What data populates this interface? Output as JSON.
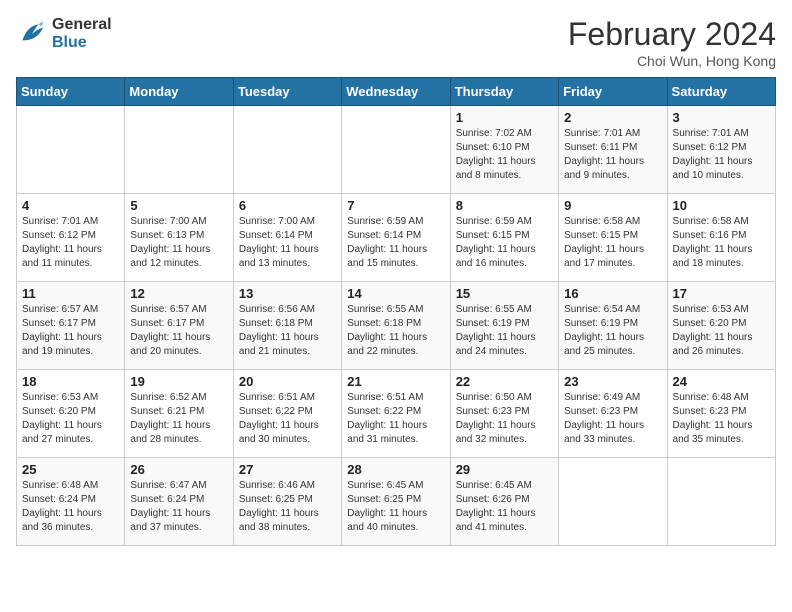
{
  "header": {
    "logo_line1": "General",
    "logo_line2": "Blue",
    "title": "February 2024",
    "subtitle": "Choi Wun, Hong Kong"
  },
  "weekdays": [
    "Sunday",
    "Monday",
    "Tuesday",
    "Wednesday",
    "Thursday",
    "Friday",
    "Saturday"
  ],
  "weeks": [
    [
      {
        "day": "",
        "info": ""
      },
      {
        "day": "",
        "info": ""
      },
      {
        "day": "",
        "info": ""
      },
      {
        "day": "",
        "info": ""
      },
      {
        "day": "1",
        "info": "Sunrise: 7:02 AM\nSunset: 6:10 PM\nDaylight: 11 hours\nand 8 minutes."
      },
      {
        "day": "2",
        "info": "Sunrise: 7:01 AM\nSunset: 6:11 PM\nDaylight: 11 hours\nand 9 minutes."
      },
      {
        "day": "3",
        "info": "Sunrise: 7:01 AM\nSunset: 6:12 PM\nDaylight: 11 hours\nand 10 minutes."
      }
    ],
    [
      {
        "day": "4",
        "info": "Sunrise: 7:01 AM\nSunset: 6:12 PM\nDaylight: 11 hours\nand 11 minutes."
      },
      {
        "day": "5",
        "info": "Sunrise: 7:00 AM\nSunset: 6:13 PM\nDaylight: 11 hours\nand 12 minutes."
      },
      {
        "day": "6",
        "info": "Sunrise: 7:00 AM\nSunset: 6:14 PM\nDaylight: 11 hours\nand 13 minutes."
      },
      {
        "day": "7",
        "info": "Sunrise: 6:59 AM\nSunset: 6:14 PM\nDaylight: 11 hours\nand 15 minutes."
      },
      {
        "day": "8",
        "info": "Sunrise: 6:59 AM\nSunset: 6:15 PM\nDaylight: 11 hours\nand 16 minutes."
      },
      {
        "day": "9",
        "info": "Sunrise: 6:58 AM\nSunset: 6:15 PM\nDaylight: 11 hours\nand 17 minutes."
      },
      {
        "day": "10",
        "info": "Sunrise: 6:58 AM\nSunset: 6:16 PM\nDaylight: 11 hours\nand 18 minutes."
      }
    ],
    [
      {
        "day": "11",
        "info": "Sunrise: 6:57 AM\nSunset: 6:17 PM\nDaylight: 11 hours\nand 19 minutes."
      },
      {
        "day": "12",
        "info": "Sunrise: 6:57 AM\nSunset: 6:17 PM\nDaylight: 11 hours\nand 20 minutes."
      },
      {
        "day": "13",
        "info": "Sunrise: 6:56 AM\nSunset: 6:18 PM\nDaylight: 11 hours\nand 21 minutes."
      },
      {
        "day": "14",
        "info": "Sunrise: 6:55 AM\nSunset: 6:18 PM\nDaylight: 11 hours\nand 22 minutes."
      },
      {
        "day": "15",
        "info": "Sunrise: 6:55 AM\nSunset: 6:19 PM\nDaylight: 11 hours\nand 24 minutes."
      },
      {
        "day": "16",
        "info": "Sunrise: 6:54 AM\nSunset: 6:19 PM\nDaylight: 11 hours\nand 25 minutes."
      },
      {
        "day": "17",
        "info": "Sunrise: 6:53 AM\nSunset: 6:20 PM\nDaylight: 11 hours\nand 26 minutes."
      }
    ],
    [
      {
        "day": "18",
        "info": "Sunrise: 6:53 AM\nSunset: 6:20 PM\nDaylight: 11 hours\nand 27 minutes."
      },
      {
        "day": "19",
        "info": "Sunrise: 6:52 AM\nSunset: 6:21 PM\nDaylight: 11 hours\nand 28 minutes."
      },
      {
        "day": "20",
        "info": "Sunrise: 6:51 AM\nSunset: 6:22 PM\nDaylight: 11 hours\nand 30 minutes."
      },
      {
        "day": "21",
        "info": "Sunrise: 6:51 AM\nSunset: 6:22 PM\nDaylight: 11 hours\nand 31 minutes."
      },
      {
        "day": "22",
        "info": "Sunrise: 6:50 AM\nSunset: 6:23 PM\nDaylight: 11 hours\nand 32 minutes."
      },
      {
        "day": "23",
        "info": "Sunrise: 6:49 AM\nSunset: 6:23 PM\nDaylight: 11 hours\nand 33 minutes."
      },
      {
        "day": "24",
        "info": "Sunrise: 6:48 AM\nSunset: 6:23 PM\nDaylight: 11 hours\nand 35 minutes."
      }
    ],
    [
      {
        "day": "25",
        "info": "Sunrise: 6:48 AM\nSunset: 6:24 PM\nDaylight: 11 hours\nand 36 minutes."
      },
      {
        "day": "26",
        "info": "Sunrise: 6:47 AM\nSunset: 6:24 PM\nDaylight: 11 hours\nand 37 minutes."
      },
      {
        "day": "27",
        "info": "Sunrise: 6:46 AM\nSunset: 6:25 PM\nDaylight: 11 hours\nand 38 minutes."
      },
      {
        "day": "28",
        "info": "Sunrise: 6:45 AM\nSunset: 6:25 PM\nDaylight: 11 hours\nand 40 minutes."
      },
      {
        "day": "29",
        "info": "Sunrise: 6:45 AM\nSunset: 6:26 PM\nDaylight: 11 hours\nand 41 minutes."
      },
      {
        "day": "",
        "info": ""
      },
      {
        "day": "",
        "info": ""
      }
    ]
  ]
}
